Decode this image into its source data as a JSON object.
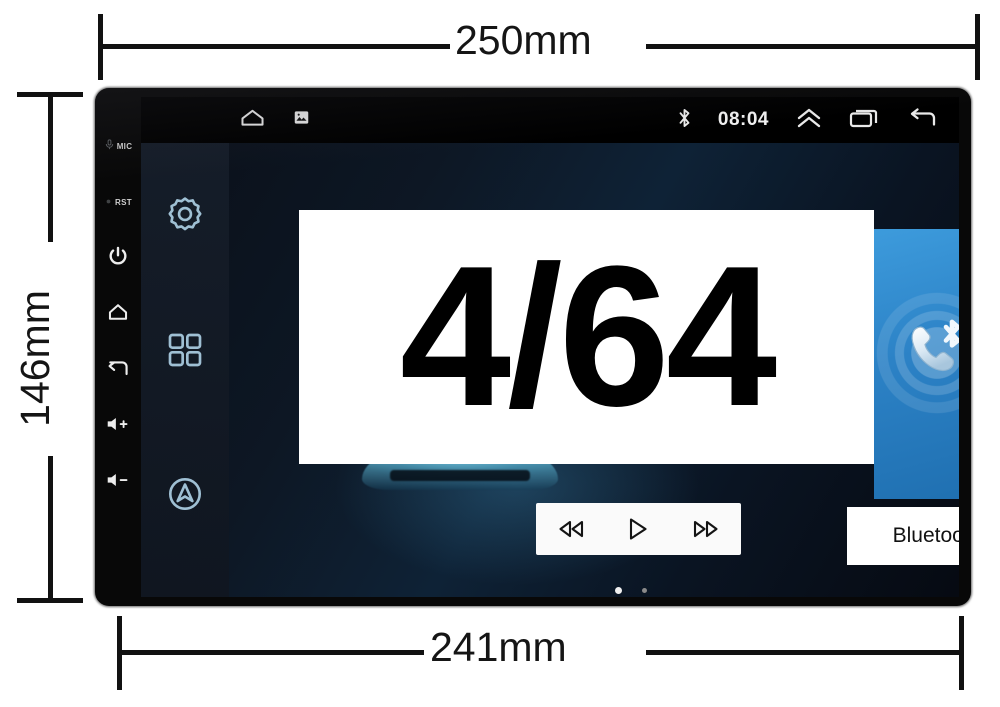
{
  "annotations": {
    "width_top": "250mm",
    "width_bottom": "241mm",
    "height_left": "146mm"
  },
  "overlay": {
    "text": "4/64"
  },
  "device": {
    "hardware_buttons": [
      {
        "name": "mic-label",
        "label": "MIC",
        "icon": "mic-icon"
      },
      {
        "name": "reset-label",
        "label": "RST",
        "icon": "reset-pinhole-icon"
      },
      {
        "name": "power-button",
        "label": "",
        "icon": "power-icon"
      },
      {
        "name": "home-button",
        "label": "",
        "icon": "home-icon"
      },
      {
        "name": "back-button",
        "label": "",
        "icon": "back-arrow-icon"
      },
      {
        "name": "volume-up-button",
        "label": "",
        "icon": "volume-up-icon"
      },
      {
        "name": "volume-down-button",
        "label": "",
        "icon": "volume-down-icon"
      }
    ]
  },
  "statusbar": {
    "left_icons": [
      {
        "name": "home-icon",
        "glyph": "home"
      },
      {
        "name": "screenshot-icon",
        "glyph": "screenshot"
      }
    ],
    "bluetooth_icon": "bluetooth-icon",
    "clock": "08:04",
    "right_icons": [
      {
        "name": "chevron-up-double-icon",
        "glyph": "chevrons-up"
      },
      {
        "name": "recent-apps-icon",
        "glyph": "recents"
      },
      {
        "name": "back-arrow-icon",
        "glyph": "back"
      }
    ]
  },
  "dock": {
    "items": [
      {
        "name": "settings-gear-icon",
        "label": ""
      },
      {
        "name": "app-grid-icon",
        "label": ""
      },
      {
        "name": "navigation-icon",
        "label": ""
      }
    ]
  },
  "widgets": {
    "bluetooth": {
      "label": "Bluetooth",
      "icon": "bluetooth-phone-icon",
      "accent_color": "#2c82c6"
    },
    "media_controls": [
      {
        "name": "previous-track-button",
        "glyph": "prev"
      },
      {
        "name": "play-button",
        "glyph": "play"
      },
      {
        "name": "next-track-button",
        "glyph": "next"
      }
    ],
    "page_dots": 2
  },
  "colors": {
    "bezel": "#080808",
    "screen_bg": "#0a1422",
    "accent_blue": "#2c82c6",
    "annotation": "#111111"
  }
}
